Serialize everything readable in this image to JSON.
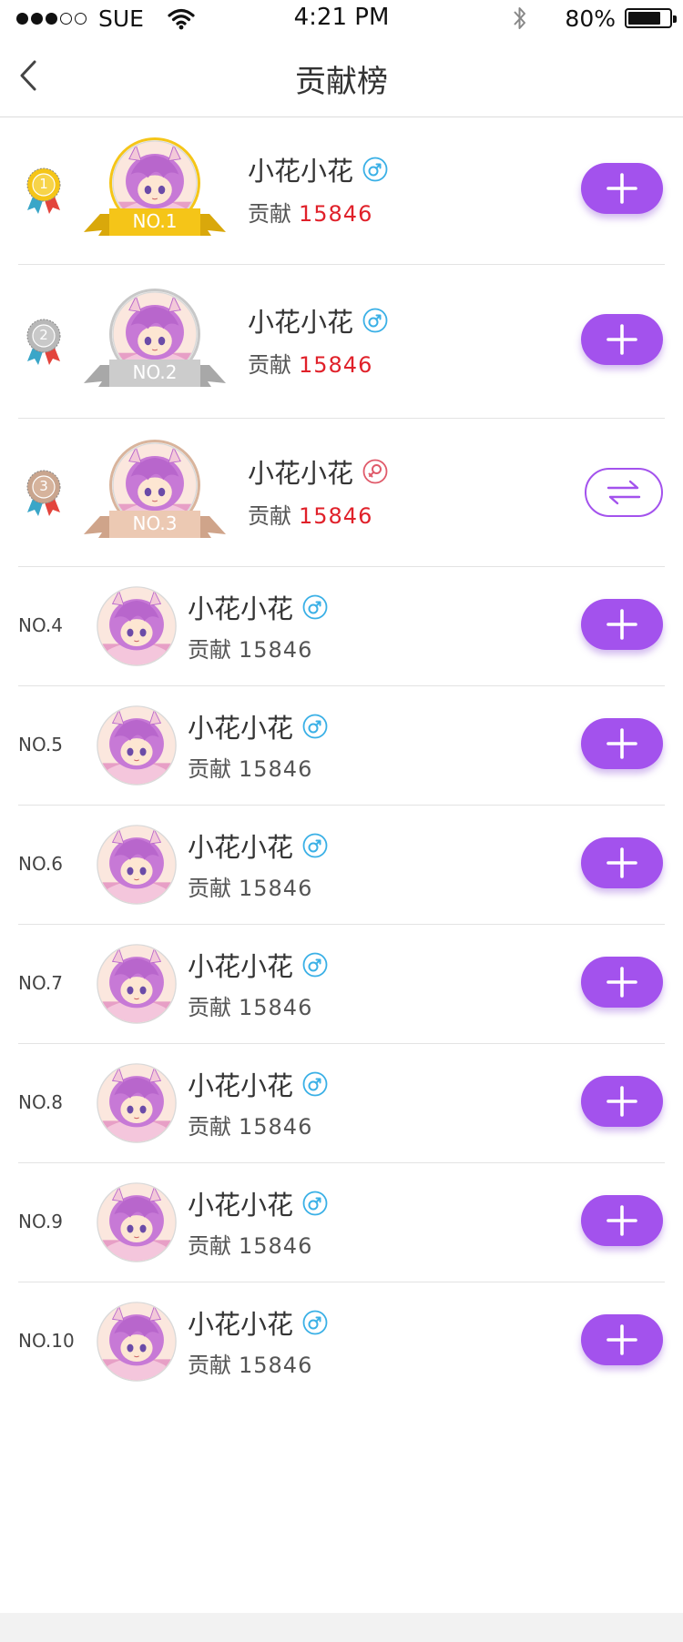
{
  "status": {
    "carrier": "SUE",
    "time": "4:21 PM",
    "battery": "80%",
    "battery_level": 0.8
  },
  "nav": {
    "title": "贡献榜"
  },
  "colors": {
    "accent": "#a352ed",
    "gold": "#f5c518",
    "silver": "#c8c8c8",
    "bronze": "#e8c2a8",
    "score_red": "#e0212a",
    "male_blue": "#3ab0e6",
    "female_red": "#e05a6a"
  },
  "top_entries": [
    {
      "rank_label": "NO.1",
      "medal_number": "1",
      "name": "小花小花",
      "gender": "male",
      "contrib_label": "贡献",
      "score": "15846",
      "action": "follow"
    },
    {
      "rank_label": "NO.2",
      "medal_number": "2",
      "name": "小花小花",
      "gender": "male",
      "contrib_label": "贡献",
      "score": "15846",
      "action": "follow"
    },
    {
      "rank_label": "NO.3",
      "medal_number": "3",
      "name": "小花小花",
      "gender": "female",
      "contrib_label": "贡献",
      "score": "15846",
      "action": "mutual"
    }
  ],
  "entries": [
    {
      "rank": "NO.4",
      "name": "小花小花",
      "gender": "male",
      "contrib_label": "贡献",
      "score": "15846",
      "action": "follow"
    },
    {
      "rank": "NO.5",
      "name": "小花小花",
      "gender": "male",
      "contrib_label": "贡献",
      "score": "15846",
      "action": "follow"
    },
    {
      "rank": "NO.6",
      "name": "小花小花",
      "gender": "male",
      "contrib_label": "贡献",
      "score": "15846",
      "action": "follow"
    },
    {
      "rank": "NO.7",
      "name": "小花小花",
      "gender": "male",
      "contrib_label": "贡献",
      "score": "15846",
      "action": "follow"
    },
    {
      "rank": "NO.8",
      "name": "小花小花",
      "gender": "male",
      "contrib_label": "贡献",
      "score": "15846",
      "action": "follow"
    },
    {
      "rank": "NO.9",
      "name": "小花小花",
      "gender": "male",
      "contrib_label": "贡献",
      "score": "15846",
      "action": "follow"
    },
    {
      "rank": "NO.10",
      "name": "小花小花",
      "gender": "male",
      "contrib_label": "贡献",
      "score": "15846",
      "action": "follow"
    }
  ]
}
